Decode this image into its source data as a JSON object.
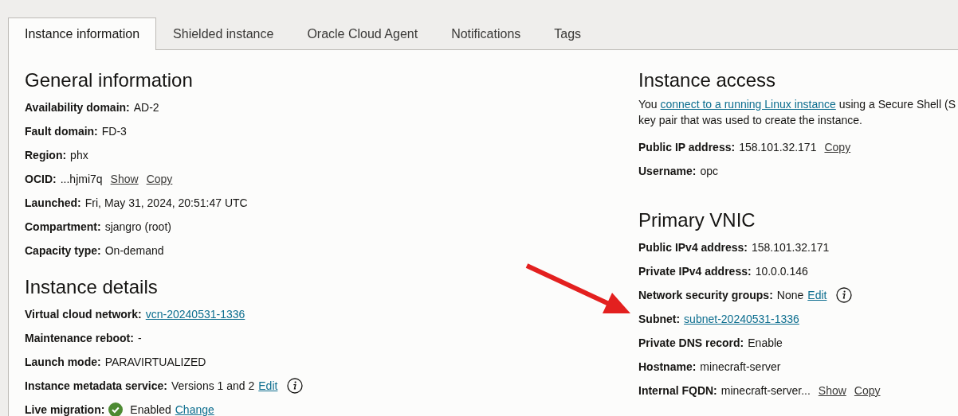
{
  "tabs": [
    {
      "label": "Instance information",
      "selected": true
    },
    {
      "label": "Shielded instance",
      "selected": false
    },
    {
      "label": "Oracle Cloud Agent",
      "selected": false
    },
    {
      "label": "Notifications",
      "selected": false
    },
    {
      "label": "Tags",
      "selected": false
    }
  ],
  "columns": [
    {
      "sections": [
        {
          "title": "General information",
          "rows": [
            {
              "label": "Availability domain:",
              "parts": [
                {
                  "kind": "text",
                  "text": "AD-2"
                }
              ]
            },
            {
              "label": "Fault domain:",
              "parts": [
                {
                  "kind": "text",
                  "text": "FD-3"
                }
              ]
            },
            {
              "label": "Region:",
              "parts": [
                {
                  "kind": "text",
                  "text": "phx"
                }
              ]
            },
            {
              "label": "OCID:",
              "parts": [
                {
                  "kind": "text",
                  "text": "...hjmi7q"
                },
                {
                  "kind": "action",
                  "text": "Show"
                },
                {
                  "kind": "action",
                  "text": "Copy"
                }
              ]
            },
            {
              "label": "Launched:",
              "parts": [
                {
                  "kind": "text",
                  "text": "Fri, May 31, 2024, 20:51:47 UTC"
                }
              ]
            },
            {
              "label": "Compartment:",
              "parts": [
                {
                  "kind": "text",
                  "text": "sjangro (root)"
                }
              ]
            },
            {
              "label": "Capacity type:",
              "parts": [
                {
                  "kind": "text",
                  "text": "On-demand"
                }
              ]
            }
          ]
        },
        {
          "title": "Instance details",
          "rows": [
            {
              "label": "Virtual cloud network:",
              "parts": [
                {
                  "kind": "link",
                  "text": "vcn-20240531-1336"
                }
              ]
            },
            {
              "label": "Maintenance reboot:",
              "parts": [
                {
                  "kind": "text",
                  "text": "-"
                }
              ]
            },
            {
              "label": "Launch mode:",
              "parts": [
                {
                  "kind": "text",
                  "text": "PARAVIRTUALIZED"
                }
              ]
            },
            {
              "label": "Instance metadata service:",
              "parts": [
                {
                  "kind": "text",
                  "text": "Versions 1 and 2"
                },
                {
                  "kind": "link",
                  "text": "Edit"
                },
                {
                  "kind": "info"
                }
              ]
            },
            {
              "label": "Live migration:",
              "parts": [
                {
                  "kind": "check"
                },
                {
                  "kind": "text",
                  "text": "Enabled"
                },
                {
                  "kind": "link",
                  "text": "Change"
                }
              ]
            }
          ]
        }
      ]
    },
    {
      "sections": [
        {
          "title": "Instance access",
          "intro": {
            "before": "You ",
            "link": "connect to a running Linux instance",
            "after": " using a Secure Shell (S",
            "line2": "key pair that was used to create the instance."
          },
          "rows": [
            {
              "label": "Public IP address:",
              "parts": [
                {
                  "kind": "text",
                  "text": "158.101.32.171"
                },
                {
                  "kind": "action",
                  "text": "Copy"
                }
              ]
            },
            {
              "label": "Username:",
              "parts": [
                {
                  "kind": "text",
                  "text": "opc"
                }
              ]
            }
          ]
        },
        {
          "title": "Primary VNIC",
          "rows": [
            {
              "label": "Public IPv4 address:",
              "parts": [
                {
                  "kind": "text",
                  "text": "158.101.32.171"
                }
              ]
            },
            {
              "label": "Private IPv4 address:",
              "parts": [
                {
                  "kind": "text",
                  "text": "10.0.0.146"
                }
              ]
            },
            {
              "label": "Network security groups:",
              "parts": [
                {
                  "kind": "text",
                  "text": "None"
                },
                {
                  "kind": "link",
                  "text": "Edit"
                },
                {
                  "kind": "info"
                }
              ]
            },
            {
              "label": "Subnet:",
              "parts": [
                {
                  "kind": "link",
                  "text": "subnet-20240531-1336"
                }
              ]
            },
            {
              "label": "Private DNS record:",
              "parts": [
                {
                  "kind": "text",
                  "text": "Enable"
                }
              ]
            },
            {
              "label": "Hostname:",
              "parts": [
                {
                  "kind": "text",
                  "text": "minecraft-server"
                }
              ]
            },
            {
              "label": "Internal FQDN:",
              "parts": [
                {
                  "kind": "text",
                  "text": "minecraft-server..."
                },
                {
                  "kind": "action",
                  "text": "Show"
                },
                {
                  "kind": "action",
                  "text": "Copy"
                }
              ]
            }
          ]
        }
      ]
    }
  ]
}
